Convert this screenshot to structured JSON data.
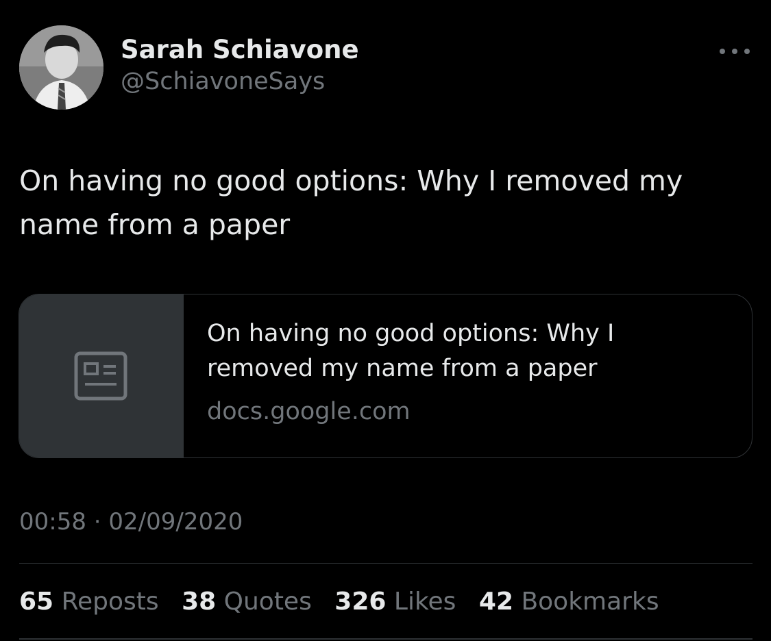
{
  "author": {
    "display_name": "Sarah Schiavone",
    "handle": "@SchiavoneSays",
    "avatar_icon": "profile-photo"
  },
  "more_icon": "more-horizontal-icon",
  "tweet": {
    "text": "On having no good options: Why I removed my name from a paper"
  },
  "link_card": {
    "thumbnail_icon": "article-icon",
    "title": "On having no good options: Why I removed my name from a paper",
    "domain": "docs.google.com"
  },
  "timestamp": {
    "time": "00:58",
    "separator": "·",
    "date": "02/09/2020"
  },
  "stats": [
    {
      "count": "65",
      "label": "Reposts"
    },
    {
      "count": "38",
      "label": "Quotes"
    },
    {
      "count": "326",
      "label": "Likes"
    },
    {
      "count": "42",
      "label": "Bookmarks"
    }
  ],
  "colors": {
    "background": "#000000",
    "primary_text": "#e7e9ea",
    "secondary_text": "#71767b",
    "border": "#2f3336",
    "card_thumb_bg": "#2f3336"
  }
}
